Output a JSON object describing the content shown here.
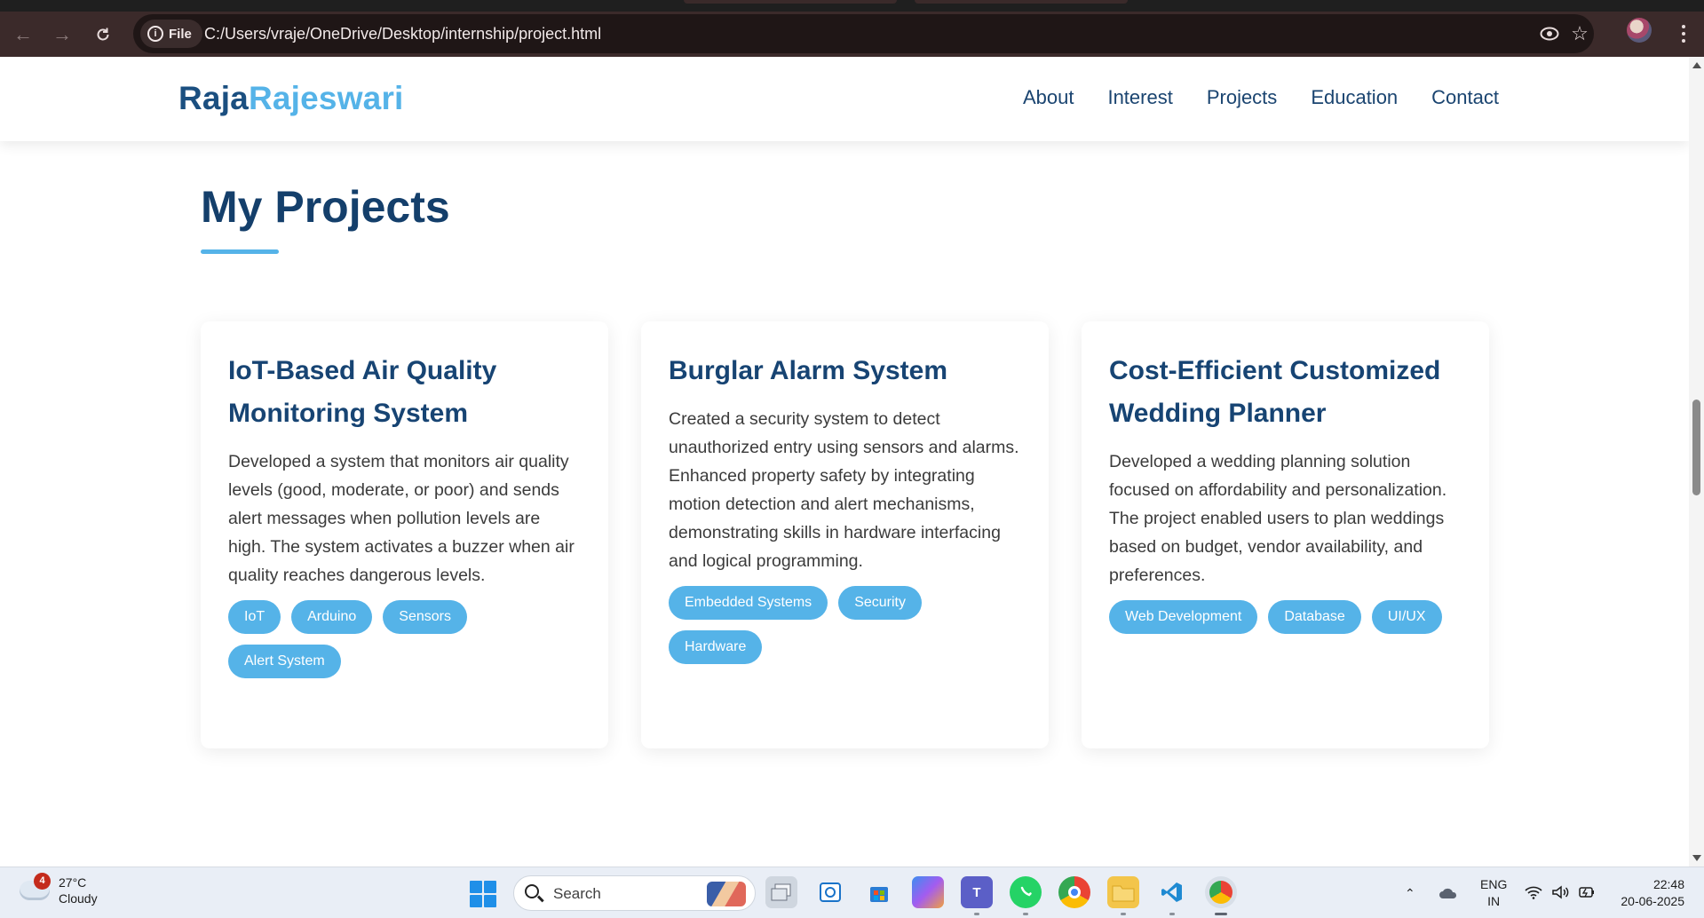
{
  "browser": {
    "site_info_label": "File",
    "url": "C:/Users/vraje/OneDrive/Desktop/internship/project.html"
  },
  "site": {
    "logo_first": "Raja",
    "logo_second": "Rajeswari",
    "nav": [
      "About",
      "Interest",
      "Projects",
      "Education",
      "Contact"
    ]
  },
  "section": {
    "title": "My Projects"
  },
  "projects": [
    {
      "title": "IoT-Based Air Quality Monitoring System",
      "description": "Developed a system that monitors air quality levels (good, moderate, or poor) and sends alert messages when pollution levels are high. The system activates a buzzer when air quality reaches dangerous levels.",
      "tags": [
        "IoT",
        "Arduino",
        "Sensors",
        "Alert System"
      ]
    },
    {
      "title": "Burglar Alarm System",
      "description": "Created a security system to detect unauthorized entry using sensors and alarms. Enhanced property safety by integrating motion detection and alert mechanisms, demonstrating skills in hardware interfacing and logical programming.",
      "tags": [
        "Embedded Systems",
        "Security",
        "Hardware"
      ]
    },
    {
      "title": "Cost-Efficient Customized Wedding Planner",
      "description": "Developed a wedding planning solution focused on affordability and personalization. The project enabled users to plan weddings based on budget, vendor availability, and preferences.",
      "tags": [
        "Web Development",
        "Database",
        "UI/UX"
      ]
    }
  ],
  "taskbar": {
    "weather_badge": "4",
    "temperature": "27°C",
    "condition": "Cloudy",
    "search_placeholder": "Search",
    "language_line1": "ENG",
    "language_line2": "IN",
    "time": "22:48",
    "date": "20-06-2025"
  },
  "colors": {
    "brand_dark": "#174473",
    "brand_light": "#55b3e8",
    "chrome_toolbar": "#3b2a2a"
  }
}
